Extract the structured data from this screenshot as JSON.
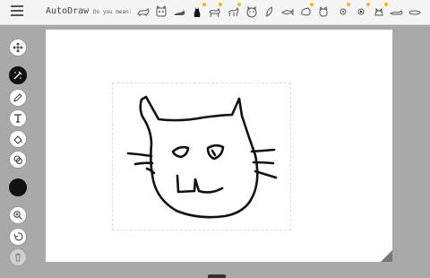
{
  "app": {
    "title": "AutoDraw"
  },
  "suggestions": {
    "prompt": "Do you mean:",
    "items": [
      {
        "name": "cat-suggestion-1",
        "icon": "cat-icon"
      },
      {
        "name": "cat-suggestion-2",
        "icon": "cat-face-icon"
      },
      {
        "name": "cat-suggestion-3",
        "icon": "cat-lying-icon"
      },
      {
        "name": "cat-suggestion-4",
        "icon": "cat-sitting-icon"
      },
      {
        "name": "cat-suggestion-5",
        "icon": "cat-walking-icon"
      },
      {
        "name": "cat-suggestion-6",
        "icon": "cat-standing-icon"
      },
      {
        "name": "cat-suggestion-7",
        "icon": "cat-face-round-icon"
      },
      {
        "name": "cat-suggestion-8",
        "icon": "leaf-icon"
      },
      {
        "name": "cat-suggestion-9",
        "icon": "fish-icon"
      },
      {
        "name": "cat-suggestion-10",
        "icon": "cat-head-icon"
      },
      {
        "name": "cat-suggestion-11",
        "icon": "cat-face-small-icon"
      },
      {
        "name": "cat-suggestion-12",
        "icon": "eye-icon"
      },
      {
        "name": "cat-suggestion-13",
        "icon": "owl-icon"
      },
      {
        "name": "cat-suggestion-14",
        "icon": "cat-outline-icon"
      },
      {
        "name": "cat-suggestion-15",
        "icon": "cat-stretch-icon"
      },
      {
        "name": "cat-suggestion-16",
        "icon": "fish-flat-icon"
      }
    ]
  },
  "toolbar": {
    "tools": [
      {
        "name": "move-tool",
        "icon": "move-icon",
        "active": false
      },
      {
        "name": "autodraw-tool",
        "icon": "autodraw-icon",
        "active": true
      },
      {
        "name": "draw-tool",
        "icon": "pencil-icon",
        "active": false
      },
      {
        "name": "type-tool",
        "icon": "text-icon",
        "active": false
      },
      {
        "name": "fill-tool",
        "icon": "fill-icon",
        "active": false
      },
      {
        "name": "shape-tool",
        "icon": "shape-icon",
        "active": false
      },
      {
        "name": "zoom-tool",
        "icon": "zoom-icon",
        "active": false
      },
      {
        "name": "undo-tool",
        "icon": "undo-icon",
        "active": false
      },
      {
        "name": "delete-tool",
        "icon": "trash-icon",
        "active": false,
        "disabled": true
      }
    ],
    "current_color": "#111111"
  },
  "colors": {
    "accent": "#f2b322",
    "topbar": "#f5f5f5",
    "background": "#a9a9a9",
    "stroke": "#111111"
  }
}
